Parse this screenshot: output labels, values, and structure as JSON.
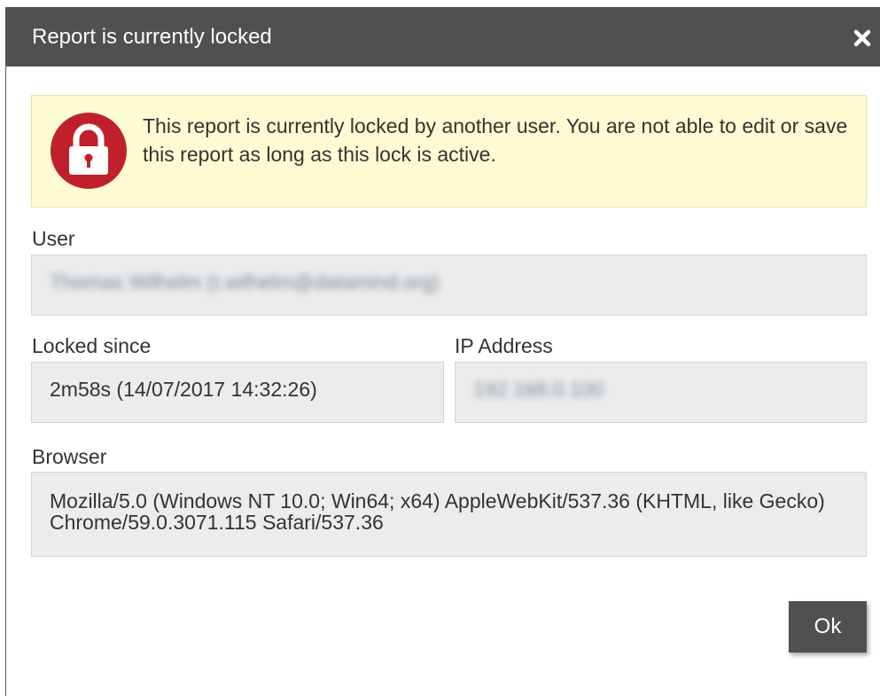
{
  "dialog": {
    "title": "Report is currently locked",
    "close_icon": "close-icon"
  },
  "alert": {
    "icon": "lock-icon",
    "message": "This report is currently locked by another user. You are not able to edit or save this report as long as this lock is active.",
    "background_color": "#fefbd4",
    "icon_color": "#c0202a"
  },
  "fields": {
    "user": {
      "label": "User",
      "value": "Thomas Wilhelm (t.wilhelm@datamind.org)"
    },
    "locked_since": {
      "label": "Locked since",
      "value": "2m58s (14/07/2017 14:32:26)"
    },
    "ip_address": {
      "label": "IP Address",
      "value": "192.168.0.100"
    },
    "browser": {
      "label": "Browser",
      "value": "Mozilla/5.0 (Windows NT 10.0; Win64; x64) AppleWebKit/537.36 (KHTML, like Gecko) Chrome/59.0.3071.115 Safari/537.36"
    }
  },
  "buttons": {
    "ok_label": "Ok"
  },
  "colors": {
    "titlebar": "#505050",
    "button": "#505050",
    "field_background": "#ececec"
  }
}
